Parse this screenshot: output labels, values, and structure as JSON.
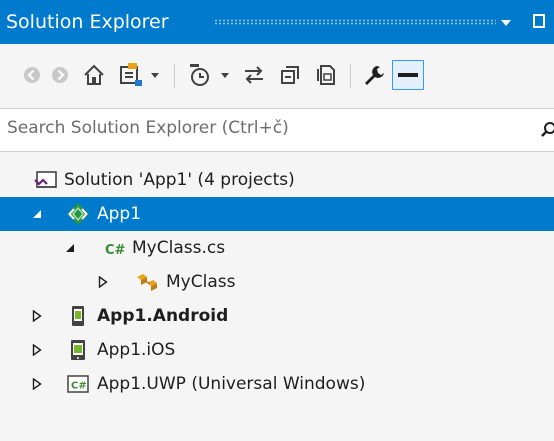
{
  "panel": {
    "title": "Solution Explorer"
  },
  "toolbar": {
    "buttons": [
      {
        "icon": "back-icon"
      },
      {
        "icon": "forward-icon"
      },
      {
        "icon": "home-icon"
      },
      {
        "icon": "switch-views-icon"
      },
      {
        "icon": "pending-changes-filter-icon"
      },
      {
        "icon": "sync-with-active-document-icon"
      },
      {
        "icon": "collapse-all-icon"
      },
      {
        "icon": "show-all-files-icon"
      },
      {
        "icon": "properties-icon"
      },
      {
        "icon": "preview-selected-items-icon"
      }
    ]
  },
  "search": {
    "placeholder": "Search Solution Explorer (Ctrl+č)"
  },
  "tree": {
    "items": [
      {
        "label": "Solution 'App1' (4 projects)",
        "icon": "solution-icon",
        "expander": "none",
        "selected": false,
        "bold": false
      },
      {
        "label": "App1",
        "icon": "shared-project-icon",
        "expander": "expanded",
        "selected": true,
        "bold": false
      },
      {
        "label": "MyClass.cs",
        "icon": "csharp-file-icon",
        "expander": "expanded",
        "selected": false,
        "bold": false
      },
      {
        "label": "MyClass",
        "icon": "class-icon",
        "expander": "collapsed",
        "selected": false,
        "bold": false
      },
      {
        "label": "App1.Android",
        "icon": "android-project-icon",
        "expander": "collapsed",
        "selected": false,
        "bold": true
      },
      {
        "label": "App1.iOS",
        "icon": "ios-project-icon",
        "expander": "collapsed",
        "selected": false,
        "bold": false
      },
      {
        "label": "App1.UWP (Universal Windows)",
        "icon": "csharp-project-icon",
        "expander": "collapsed",
        "selected": false,
        "bold": false
      }
    ]
  },
  "colors": {
    "accent": "#007acc",
    "background": "#f5f5f5",
    "text": "#1e1e1e"
  }
}
